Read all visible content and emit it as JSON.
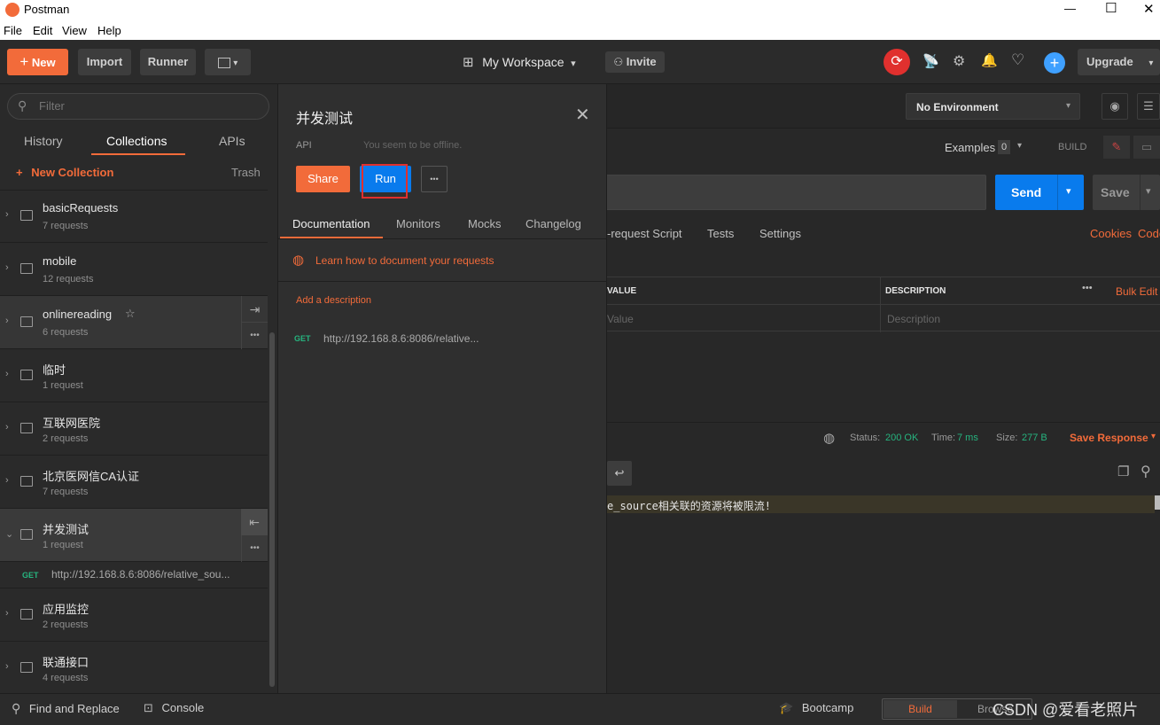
{
  "window": {
    "title": "Postman",
    "minimize": "—",
    "maximize": "☐",
    "close": "✕"
  },
  "menu": [
    "File",
    "Edit",
    "View",
    "Help"
  ],
  "toolbar": {
    "new_label": "New",
    "import_label": "Import",
    "runner_label": "Runner",
    "workspace_label": "My Workspace",
    "invite_label": "Invite",
    "upgrade_label": "Upgrade"
  },
  "sidebar": {
    "filter_placeholder": "Filter",
    "tabs": [
      "History",
      "Collections",
      "APIs"
    ],
    "new_collection": "New Collection",
    "trash": "Trash",
    "collections": [
      {
        "name": "basicRequests",
        "count": "7 requests"
      },
      {
        "name": "mobile",
        "count": "12 requests"
      },
      {
        "name": "onlinereading",
        "count": "6 requests",
        "star": "☆"
      },
      {
        "name": "临时",
        "count": "1 request"
      },
      {
        "name": "互联网医院",
        "count": "2 requests"
      },
      {
        "name": "北京医网信CA认证",
        "count": "7 requests"
      },
      {
        "name": "并发测试",
        "count": "1 request"
      },
      {
        "name": "应用监控",
        "count": "2 requests"
      },
      {
        "name": "联通接口",
        "count": "4 requests"
      }
    ],
    "expanded_request": {
      "method": "GET",
      "url": "http://192.168.8.6:8086/relative_sou..."
    }
  },
  "overlay": {
    "title": "并发测试",
    "api_label": "API",
    "offline": "You seem to be offline.",
    "share_label": "Share",
    "run_label": "Run",
    "more_label": "•••",
    "tabs": [
      "Documentation",
      "Monitors",
      "Mocks",
      "Changelog"
    ],
    "learn_link": "Learn how to document your requests",
    "add_description": "Add a description",
    "request": {
      "method": "GET",
      "url": "http://192.168.8.6:8086/relative..."
    }
  },
  "main": {
    "environment": "No Environment",
    "examples_label": "Examples",
    "examples_count": "0",
    "build_label": "BUILD",
    "send_label": "Send",
    "save_label": "Save",
    "req_tabs": [
      "-request Script",
      "Tests",
      "Settings"
    ],
    "cookies": "Cookies",
    "code": "Code",
    "table_headers": {
      "value": "VALUE",
      "description": "DESCRIPTION",
      "bulk_edit": "Bulk Edit",
      "more": "•••"
    },
    "table_placeholders": {
      "value": "Value",
      "description": "Description"
    },
    "status_label": "Status:",
    "status_value": "200 OK",
    "time_label": "Time:",
    "time_value": "7 ms",
    "size_label": "Size:",
    "size_value": "277 B",
    "save_response": "Save Response",
    "response_text": "e_source相关联的资源将被限流!"
  },
  "statusbar": {
    "find_replace": "Find and Replace",
    "console": "Console",
    "bootcamp": "Bootcamp",
    "build": "Build",
    "browse": "Browse",
    "watermark": "CSDN @爱看老照片"
  },
  "colors": {
    "accent": "#f26b3a",
    "send": "#097bed",
    "highlight": "#e0302e",
    "success": "#26b47f"
  }
}
